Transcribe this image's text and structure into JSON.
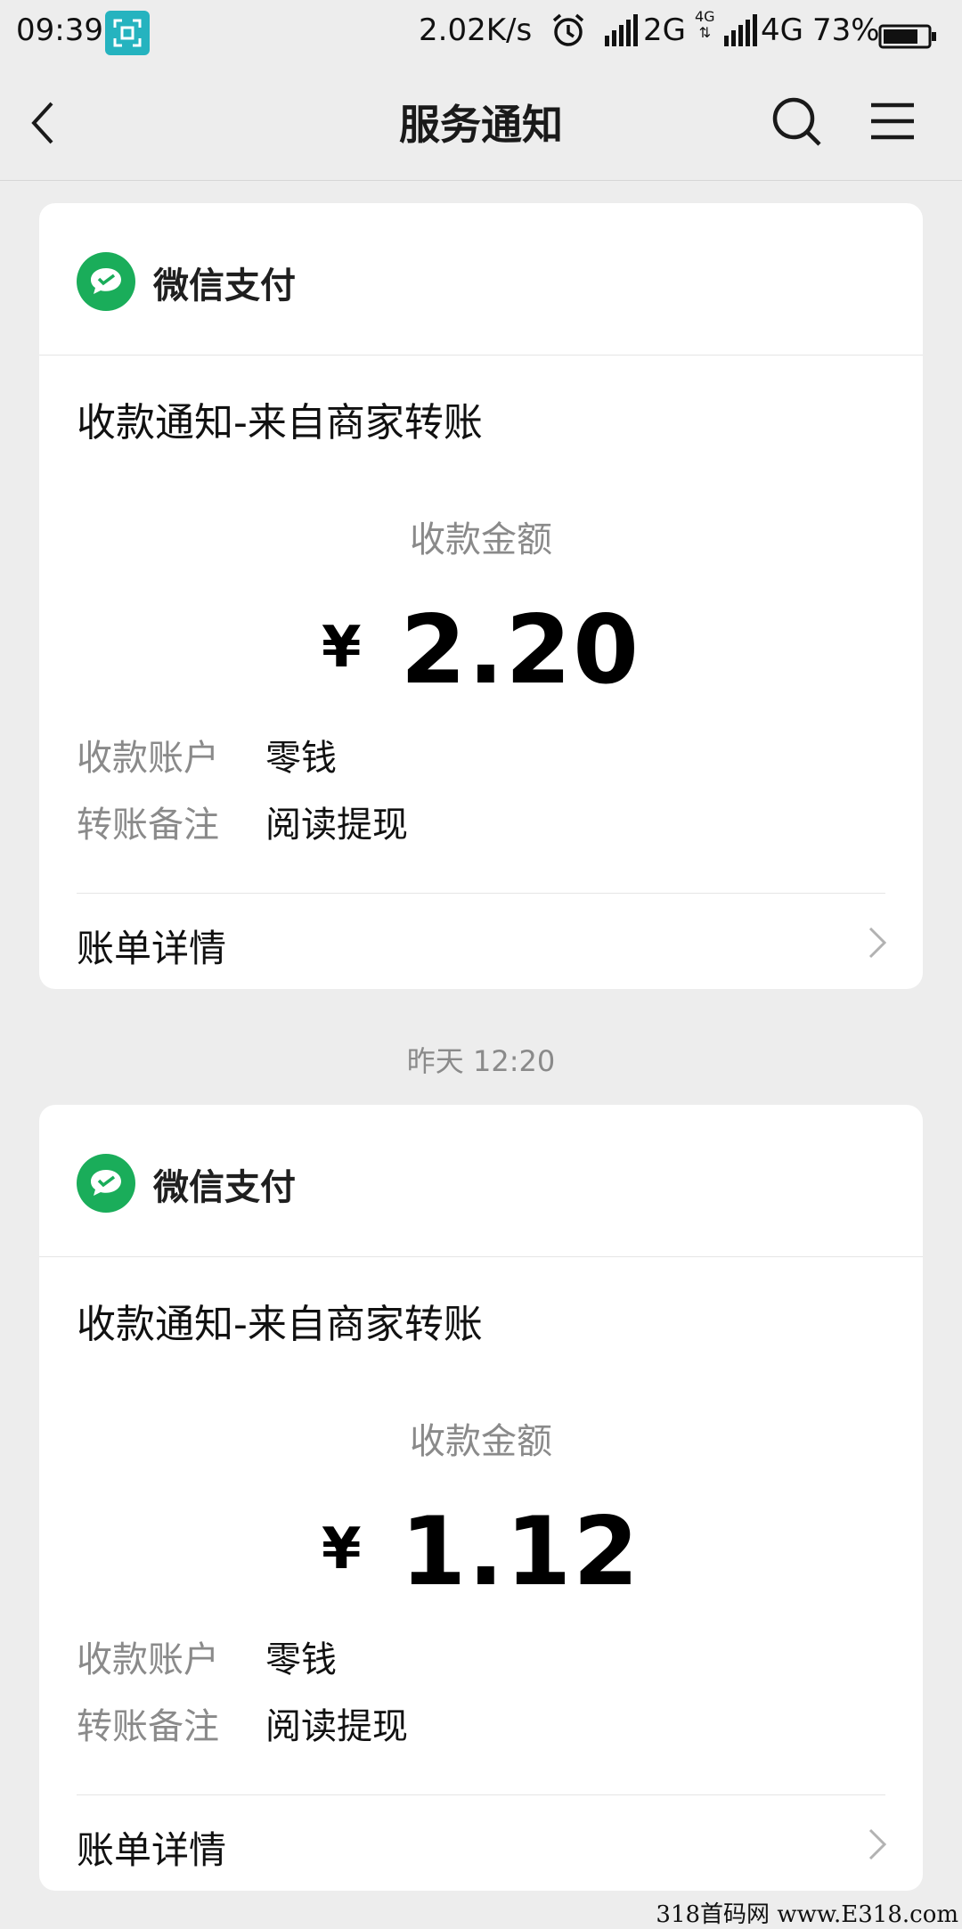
{
  "status_bar": {
    "time": "09:39",
    "net_speed": "2.02K/s",
    "network1": "2G",
    "network_small_top": "4G",
    "network_small_bottom": "⇅",
    "network2": "4G",
    "battery": "73%"
  },
  "nav": {
    "title": "服务通知"
  },
  "cards": [
    {
      "sender": "微信支付",
      "title": "收款通知-来自商家转账",
      "amount_label": "收款金额",
      "currency": "¥",
      "amount": "2.20",
      "account_key": "收款账户",
      "account_value": "零钱",
      "remark_key": "转账备注",
      "remark_value": "阅读提现",
      "details_label": "账单详情"
    },
    {
      "sender": "微信支付",
      "title": "收款通知-来自商家转账",
      "amount_label": "收款金额",
      "currency": "¥",
      "amount": "1.12",
      "account_key": "收款账户",
      "account_value": "零钱",
      "remark_key": "转账备注",
      "remark_value": "阅读提现",
      "details_label": "账单详情"
    }
  ],
  "timestamp": "昨天 12:20",
  "watermark": "318首码网 www.E318.com",
  "colors": {
    "background": "#ededed",
    "wechat_pay_green": "#1aad5a",
    "screenshot_badge": "#25b3bf"
  }
}
